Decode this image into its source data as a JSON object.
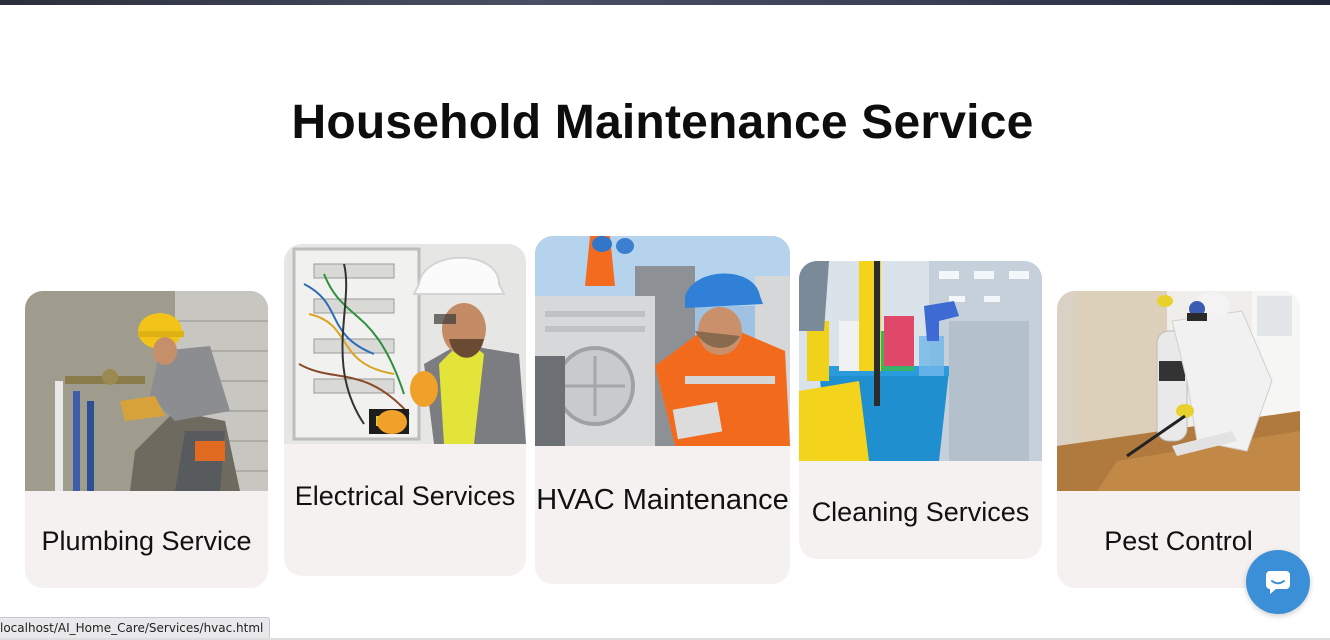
{
  "page": {
    "title": "Household Maintenance Service"
  },
  "services": [
    {
      "label": "Plumbing Service",
      "image": "plumber-photo"
    },
    {
      "label": "Electrical Services",
      "image": "electrician-photo"
    },
    {
      "label": "HVAC Maintenance",
      "image": "hvac-technician-photo"
    },
    {
      "label": "Cleaning Services",
      "image": "cleaning-supplies-photo"
    },
    {
      "label": "Pest Control",
      "image": "pest-control-photo"
    }
  ],
  "status_bar": {
    "url": "localhost/AI_Home_Care/Services/hvac.html"
  },
  "chat": {
    "icon": "chat-bubble-icon",
    "color": "#3b8fd6"
  },
  "colors": {
    "card_background": "#f5f1f0",
    "heading": "#0d0d0d"
  }
}
